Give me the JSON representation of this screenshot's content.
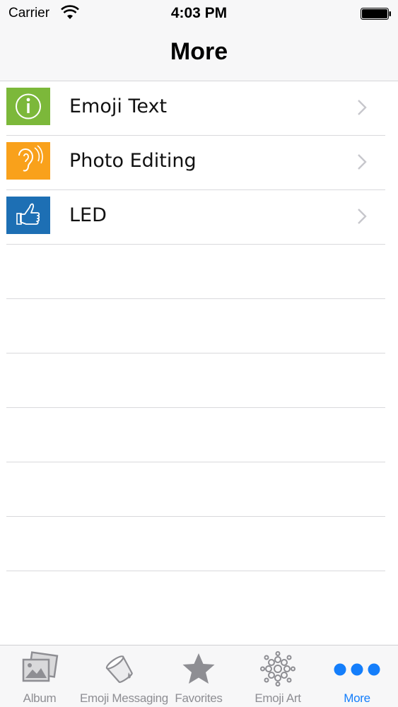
{
  "status_bar": {
    "carrier": "Carrier",
    "time": "4:03 PM"
  },
  "nav_bar": {
    "title": "More"
  },
  "menu": {
    "items": [
      {
        "label": "Emoji Text",
        "icon": "info-icon",
        "tile_color": "#7cb83a"
      },
      {
        "label": "Photo Editing",
        "icon": "ear-icon",
        "tile_color": "#f9a11b"
      },
      {
        "label": "LED",
        "icon": "thumbs-up-icon",
        "tile_color": "#1d6fb4"
      }
    ]
  },
  "tab_bar": {
    "tabs": [
      {
        "label": "Album",
        "icon": "photo-album-icon",
        "active": false
      },
      {
        "label": "Emoji Messaging",
        "icon": "paint-bucket-icon",
        "active": false
      },
      {
        "label": "Favorites",
        "icon": "star-icon",
        "active": false
      },
      {
        "label": "Emoji Art",
        "icon": "flower-dots-icon",
        "active": false
      },
      {
        "label": "More",
        "icon": "more-dots-icon",
        "active": true
      }
    ],
    "active_color": "#147efb",
    "inactive_color": "#8e8e93"
  }
}
